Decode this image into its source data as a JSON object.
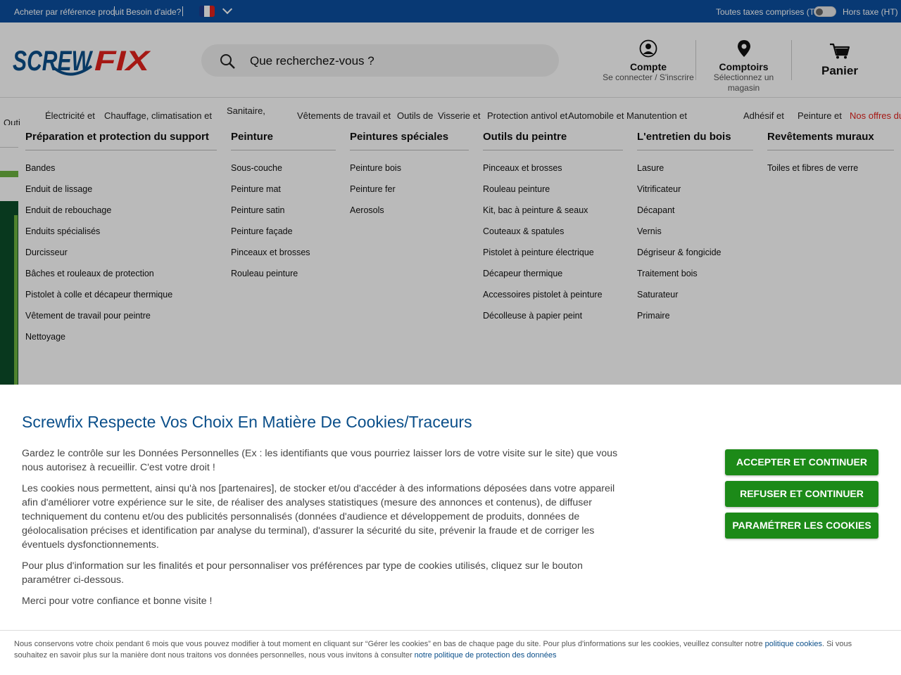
{
  "topbar": {
    "buy_by_ref": "Acheter par référence produit",
    "help": "Besoin d'aide?",
    "ttc": "Toutes taxes comprises (TTC)",
    "ht": "Hors taxe (HT)"
  },
  "header": {
    "logo_text": "SCREWFIX",
    "search_placeholder": "Que recherchez-vous ?",
    "account_title": "Compte",
    "account_sub": "Se connecter / S'inscrire",
    "stores_title": "Comptoirs",
    "stores_sub_1": "Sélectionnez un",
    "stores_sub_2": "magasin",
    "cart": "Panier"
  },
  "nav": {
    "items": [
      "Outi",
      "Électricité et",
      "Chauffage, climatisation et",
      "Sanitaire,",
      "Vêtements de travail et",
      "Outils de",
      "Visserie et",
      "Protection antivol et",
      "Automobile et",
      "Manutention et",
      "Adhésif et",
      "Peinture et",
      "Nos offres du"
    ]
  },
  "mega": {
    "columns": [
      {
        "title": "Préparation et protection du support",
        "items": [
          "Bandes",
          "Enduit de lissage",
          "Enduit de rebouchage",
          "Enduits spécialisés",
          "Durcisseur",
          "Bâches et rouleaux de protection",
          "Pistolet à colle et décapeur thermique",
          "Vêtement de travail pour peintre",
          "Nettoyage"
        ]
      },
      {
        "title": "Peinture",
        "items": [
          "Sous-couche",
          "Peinture mat",
          "Peinture satin",
          "Peinture façade",
          "Pinceaux et brosses",
          "Rouleau peinture"
        ]
      },
      {
        "title": "Peintures spéciales",
        "items": [
          "Peinture bois",
          "Peinture fer",
          "Aerosols"
        ]
      },
      {
        "title": "Outils du peintre",
        "items": [
          "Pinceaux et brosses",
          "Rouleau peinture",
          "Kit, bac à peinture & seaux",
          "Couteaux & spatules",
          "Pistolet à peinture électrique",
          "Décapeur thermique",
          "Accessoires pistolet à peinture",
          "Décolleuse à papier peint"
        ]
      },
      {
        "title": "L'entretien du bois",
        "items": [
          "Lasure",
          "Vitrificateur",
          "Décapant",
          "Vernis",
          "Dégriseur & fongicide",
          "Traitement bois",
          "Saturateur",
          "Primaire"
        ]
      },
      {
        "title": "Revêtements muraux",
        "items": [
          "Toiles et fibres de verre"
        ]
      }
    ]
  },
  "cookie": {
    "title": "Screwfix Respecte Vos Choix En Matière De Cookies/Traceurs",
    "p1": "Gardez le contrôle sur les Données Personnelles (Ex : les identifiants que vous pourriez laisser lors de votre visite sur le site) que vous nous autorisez à recueillir. C'est votre droit !",
    "p2": "Les cookies nous permettent, ainsi qu'à nos [partenaires], de stocker et/ou d'accéder à des informations déposées dans votre appareil afin d'améliorer votre expérience sur le site, de réaliser des analyses statistiques (mesure des annonces et contenus), de diffuser techniquement du contenu et/ou des publicités personnalisés (données d'audience et développement de produits, données de géolocalisation précises et identification par analyse du terminal), d'assurer la sécurité du site, prévenir la fraude et de corriger les éventuels dysfonctionnements.",
    "p3": "Pour plus d'information sur les finalités et pour personnaliser vos préférences par type de cookies utilisés, cliquez sur le bouton paramétrer ci-dessous.",
    "p4": "Merci pour votre confiance et bonne visite !",
    "accept": "ACCEPTER ET CONTINUER",
    "refuse": "REFUSER ET CONTINUER",
    "settings": "PARAMÉTRER LES COOKIES",
    "footer_a": "Nous conservons votre choix pendant 6 mois que vous pouvez modifier à tout moment en cliquant sur “Gérer les cookies” en bas de chaque page du site. Pour plus d'informations sur les cookies, veuillez consulter notre ",
    "footer_link1": "politique cookies",
    "footer_b": ". Si vous souhaitez en savoir plus sur la manière dont nous traitons vos données personnelles, nous vous invitons à consulter ",
    "footer_link2": "notre politique de protection des données"
  },
  "colors": {
    "topbar": "#0b4fa0",
    "brand_blue": "#0b4f8a",
    "brand_red": "#e2211c",
    "button_green": "#1c8a18"
  }
}
